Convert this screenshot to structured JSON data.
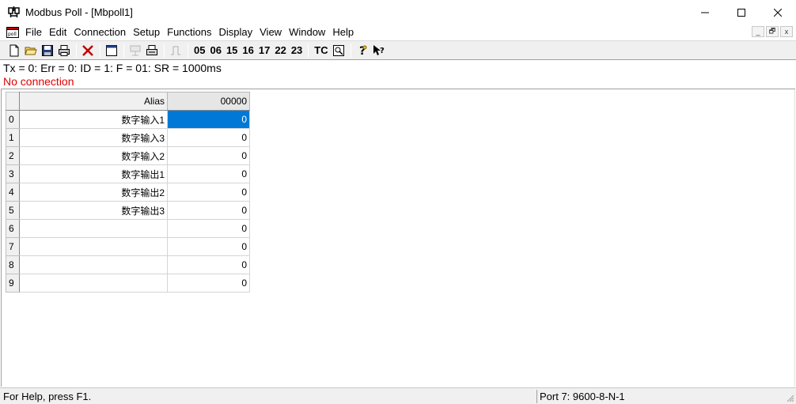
{
  "window": {
    "title": "Modbus Poll - [Mbpoll1]",
    "minimize_glyph": "—",
    "maximize_glyph": "☐",
    "close_glyph": "✕"
  },
  "menu": {
    "items": [
      "File",
      "Edit",
      "Connection",
      "Setup",
      "Functions",
      "Display",
      "View",
      "Window",
      "Help"
    ],
    "mdi_minimize": "_",
    "mdi_restore": "🗗",
    "mdi_close": "x"
  },
  "toolbar": {
    "function_codes": [
      "05",
      "06",
      "15",
      "16",
      "17",
      "22",
      "23"
    ],
    "tc_label": "TC"
  },
  "status": {
    "line": "Tx = 0: Err = 0: ID = 1: F = 01: SR = 1000ms",
    "connection": "No connection",
    "connection_color": "#e00000"
  },
  "grid": {
    "headers": {
      "alias": "Alias",
      "value": "00000"
    },
    "rows": [
      {
        "num": "0",
        "alias": "数字输入1",
        "value": "0"
      },
      {
        "num": "1",
        "alias": "数字输入3",
        "value": "0"
      },
      {
        "num": "2",
        "alias": "数字输入2",
        "value": "0"
      },
      {
        "num": "3",
        "alias": "数字输出1",
        "value": "0"
      },
      {
        "num": "4",
        "alias": "数字输出2",
        "value": "0"
      },
      {
        "num": "5",
        "alias": "数字输出3",
        "value": "0"
      },
      {
        "num": "6",
        "alias": "",
        "value": "0"
      },
      {
        "num": "7",
        "alias": "",
        "value": "0"
      },
      {
        "num": "8",
        "alias": "",
        "value": "0"
      },
      {
        "num": "9",
        "alias": "",
        "value": "0"
      }
    ],
    "selected_color": "#0078d7"
  },
  "statusbar": {
    "help": "For Help, press F1.",
    "port": "Port 7: 9600-8-N-1"
  }
}
